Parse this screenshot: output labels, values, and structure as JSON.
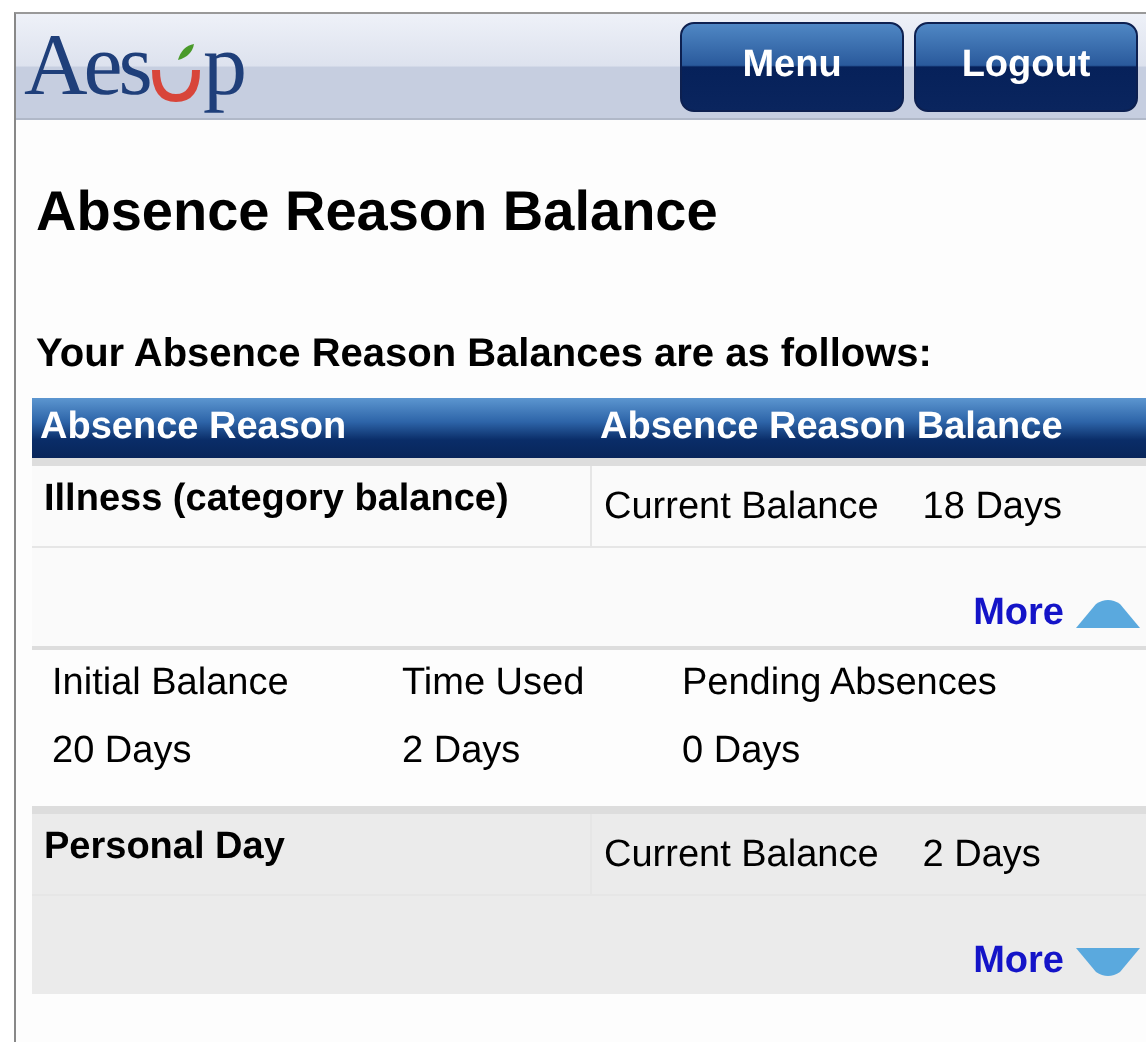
{
  "header": {
    "logo": {
      "before": "Aes",
      "after": "p"
    },
    "buttons": [
      "Menu",
      "Logout"
    ]
  },
  "title": "Absence Reason Balance",
  "subtitle": "Your Absence Reason Balances are as follows:",
  "table": {
    "columns": [
      "Absence Reason",
      "Absence Reason Balance"
    ],
    "rows": [
      {
        "reason": "Illness (category balance)",
        "balance_label": "Current Balance",
        "balance": "18 Days",
        "more": "More",
        "expanded": true,
        "details": [
          {
            "label": "Initial Balance",
            "value": "20 Days"
          },
          {
            "label": "Time Used",
            "value": "2 Days"
          },
          {
            "label": "Pending Absences",
            "value": "0 Days"
          }
        ]
      },
      {
        "reason": "Personal Day",
        "balance_label": "Current Balance",
        "balance": "2 Days",
        "more": "More",
        "expanded": false
      }
    ]
  }
}
